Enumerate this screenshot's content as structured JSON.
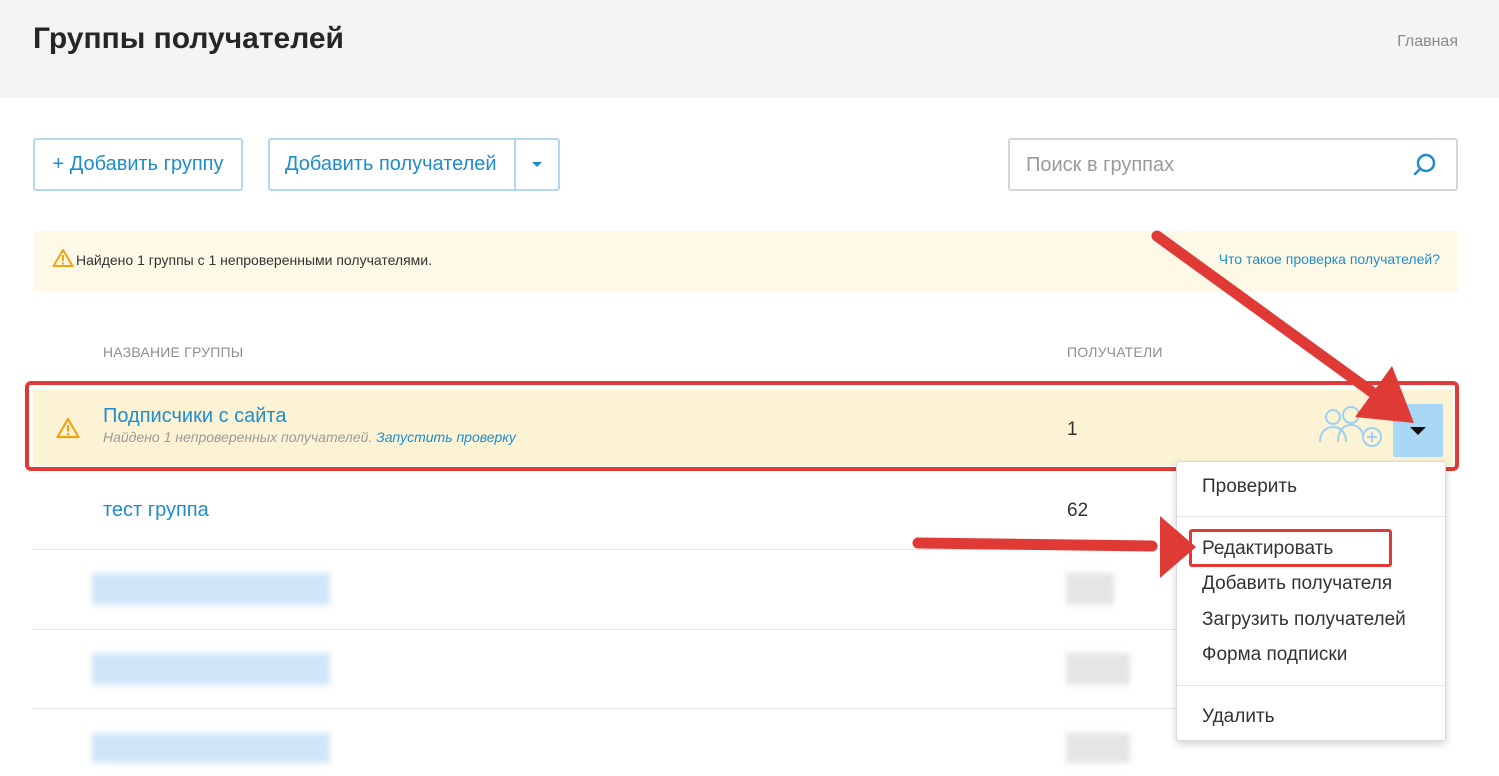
{
  "header": {
    "title": "Группы получателей",
    "breadcrumb": "Главная"
  },
  "toolbar": {
    "add_group_label": "+ Добавить группу",
    "add_recipients_label": "Добавить получателей",
    "search_placeholder": "Поиск в группах",
    "search_value": ""
  },
  "alert": {
    "text": "Найдено 1 группы с 1 непроверенными получателями.",
    "link": "Что такое проверка получателей?"
  },
  "table": {
    "columns": [
      "НАЗВАНИЕ ГРУППЫ",
      "ПОЛУЧАТЕЛИ"
    ],
    "rows": [
      {
        "name": "Подписчики с сайта",
        "note": "Найдено 1 непроверенных получателей.",
        "note_action": "Запустить проверку",
        "count": "1"
      },
      {
        "name": "тест группа",
        "count": "62"
      }
    ]
  },
  "dropdown_menu": {
    "items": [
      "Проверить",
      "Редактировать",
      "Добавить получателя",
      "Загрузить получателей",
      "Форма подписки",
      "Удалить"
    ]
  },
  "icons": {
    "warning": "warning-icon",
    "search": "search-icon",
    "add_users": "add-users-icon"
  },
  "colors": {
    "accent": "#1f8ccd",
    "warning_bg": "#fcf3d5",
    "highlight_red": "#e03a36",
    "action_button": "#a9d8f6"
  }
}
